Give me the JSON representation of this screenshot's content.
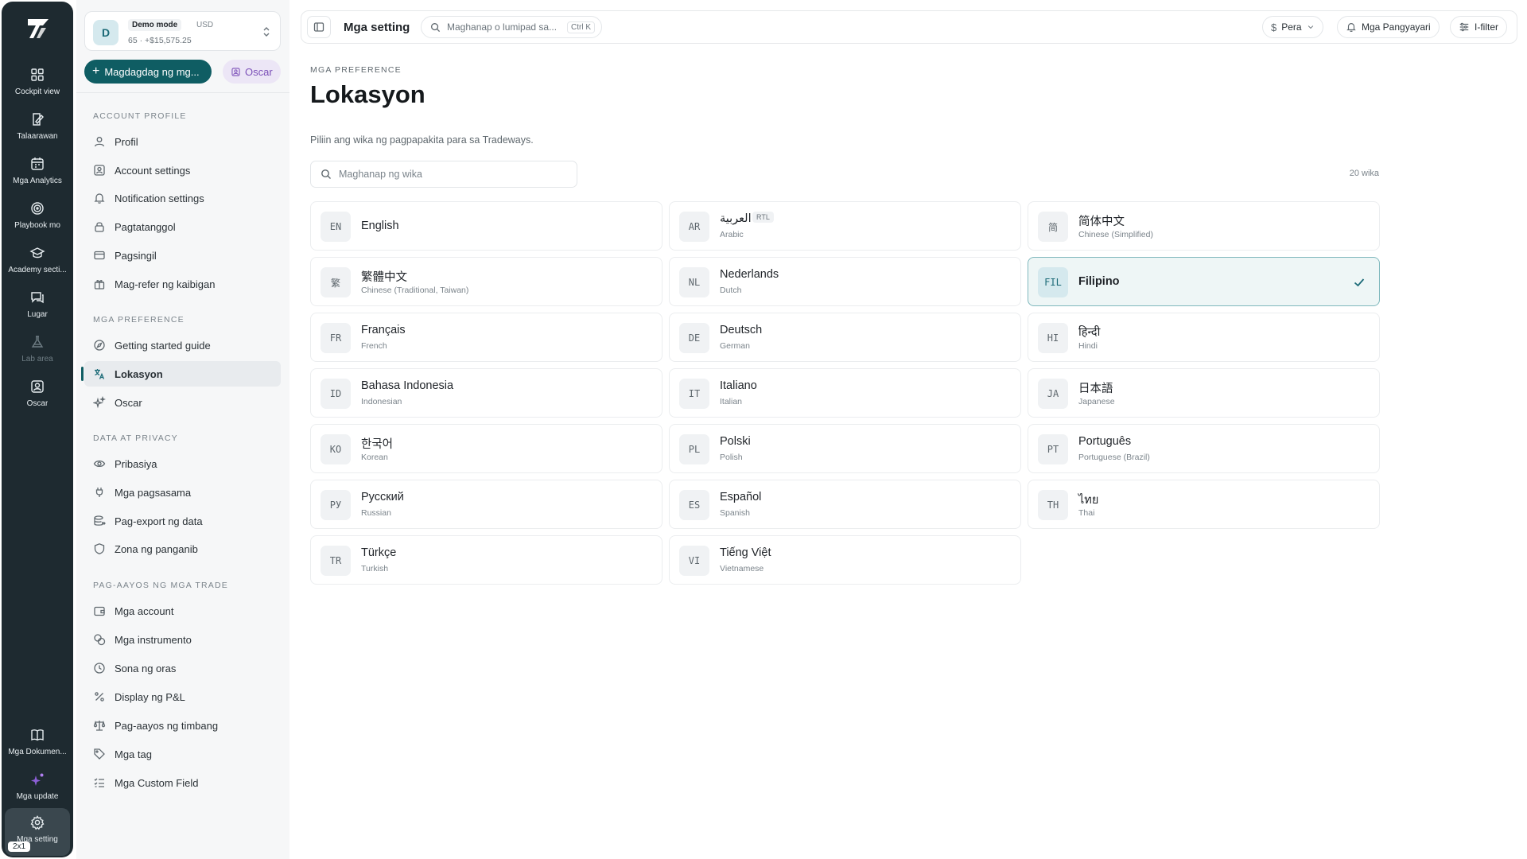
{
  "rail": {
    "items": [
      {
        "label": "Cockpit view",
        "icon": "dashboard-icon"
      },
      {
        "label": "Talaarawan",
        "icon": "journal-icon"
      },
      {
        "label": "Mga Analytics",
        "icon": "calendar-icon"
      },
      {
        "label": "Playbook mo",
        "icon": "target-icon"
      },
      {
        "label": "Academy secti...",
        "icon": "graduation-cap-icon"
      },
      {
        "label": "Lugar",
        "icon": "chat-icon"
      },
      {
        "label": "Lab area",
        "icon": "flask-icon"
      },
      {
        "label": "Oscar",
        "icon": "oscar-icon"
      }
    ],
    "bottom_items": [
      {
        "label": "Mga Dokumen...",
        "icon": "book-icon"
      },
      {
        "label": "Mga update",
        "icon": "sparkle-icon"
      },
      {
        "label": "Mga setting",
        "icon": "gear-icon"
      }
    ],
    "badge": "2x1"
  },
  "account": {
    "avatar_letter": "D",
    "mode": "Demo mode",
    "currency": "USD",
    "stats": "65 · +$15,575.25"
  },
  "sidebar": {
    "add_button": "Magdagdag ng mg...",
    "oscar_chip": "Oscar",
    "sections": [
      {
        "title": "Account profile",
        "items": [
          "Profil",
          "Account settings",
          "Notification settings",
          "Pagtatanggol",
          "Pagsingil",
          "Mag-refer ng kaibigan"
        ]
      },
      {
        "title": "Mga preference",
        "items": [
          "Getting started guide",
          "Lokasyon",
          "Oscar"
        ]
      },
      {
        "title": "Data at privacy",
        "items": [
          "Pribasiya",
          "Mga pagsasama",
          "Pag-export ng data",
          "Zona ng panganib"
        ]
      },
      {
        "title": "Pag-aayos ng mga trade",
        "items": [
          "Mga account",
          "Mga instrumento",
          "Sona ng oras",
          "Display ng P&L",
          "Pag-aayos ng timbang",
          "Mga tag",
          "Mga Custom Field"
        ]
      }
    ]
  },
  "topbar": {
    "title": "Mga setting",
    "search_placeholder": "Maghanap o lumipad sa...",
    "search_kbd": "Ctrl K",
    "currency_btn": "Pera",
    "notifications_btn": "Mga Pangyayari",
    "filter_btn": "I-filter"
  },
  "main": {
    "eyebrow": "Mga preference",
    "title": "Lokasyon",
    "description": "Piliin ang wika ng pagpapakita para sa Tradeways.",
    "search_placeholder": "Maghanap ng wika",
    "count": "20 wika",
    "languages": [
      {
        "code": "EN",
        "name": "English",
        "english": ""
      },
      {
        "code": "AR",
        "name": "العربية",
        "english": "Arabic",
        "badge": "RTL"
      },
      {
        "code": "简",
        "name": "简体中文",
        "english": "Chinese (Simplified)"
      },
      {
        "code": "繁",
        "name": "繁體中文",
        "english": "Chinese (Traditional, Taiwan)"
      },
      {
        "code": "NL",
        "name": "Nederlands",
        "english": "Dutch"
      },
      {
        "code": "FIL",
        "name": "Filipino",
        "english": "",
        "selected": true
      },
      {
        "code": "FR",
        "name": "Français",
        "english": "French"
      },
      {
        "code": "DE",
        "name": "Deutsch",
        "english": "German"
      },
      {
        "code": "HI",
        "name": "हिन्दी",
        "english": "Hindi"
      },
      {
        "code": "ID",
        "name": "Bahasa Indonesia",
        "english": "Indonesian"
      },
      {
        "code": "IT",
        "name": "Italiano",
        "english": "Italian"
      },
      {
        "code": "JA",
        "name": "日本語",
        "english": "Japanese"
      },
      {
        "code": "KO",
        "name": "한국어",
        "english": "Korean"
      },
      {
        "code": "PL",
        "name": "Polski",
        "english": "Polish"
      },
      {
        "code": "PT",
        "name": "Português",
        "english": "Portuguese (Brazil)"
      },
      {
        "code": "РУ",
        "name": "Русский",
        "english": "Russian"
      },
      {
        "code": "ES",
        "name": "Español",
        "english": "Spanish"
      },
      {
        "code": "TH",
        "name": "ไทย",
        "english": "Thai"
      },
      {
        "code": "TR",
        "name": "Türkçe",
        "english": "Turkish"
      },
      {
        "code": "VI",
        "name": "Tiếng Việt",
        "english": "Vietnamese"
      }
    ]
  },
  "colors": {
    "accent": "#0f5d63",
    "rail_bg": "#1e2a30",
    "selected_bg": "#eef6f6",
    "oscar_purple": "#7b4fb8"
  }
}
